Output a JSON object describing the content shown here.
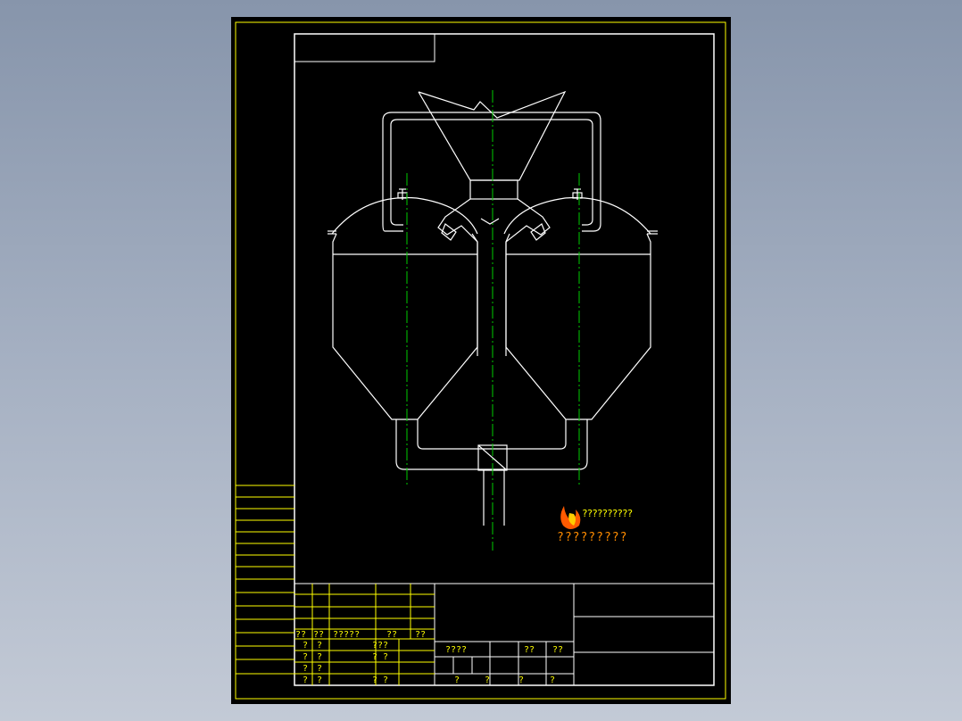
{
  "colors": {
    "background": "#000000",
    "outline": "#ffffff",
    "title_block": "#ffff00",
    "centerline": "#00cc00",
    "watermark": "#ff8c00"
  },
  "watermark": {
    "line1": "??????????",
    "line2": "?????????"
  },
  "parts_table": {
    "headers": [
      "??",
      "??",
      "?????",
      "??",
      "??"
    ],
    "rows": [
      [
        "?",
        "?",
        "???"
      ],
      [
        "?",
        "?",
        "? ?"
      ],
      [
        "?",
        "?",
        ""
      ],
      [
        "?",
        "?",
        "? ?"
      ]
    ]
  },
  "scale_row": {
    "label": "????",
    "cell_a": "??",
    "cell_b": "??"
  },
  "bottom_row": [
    "?",
    "?",
    "?",
    "?"
  ]
}
